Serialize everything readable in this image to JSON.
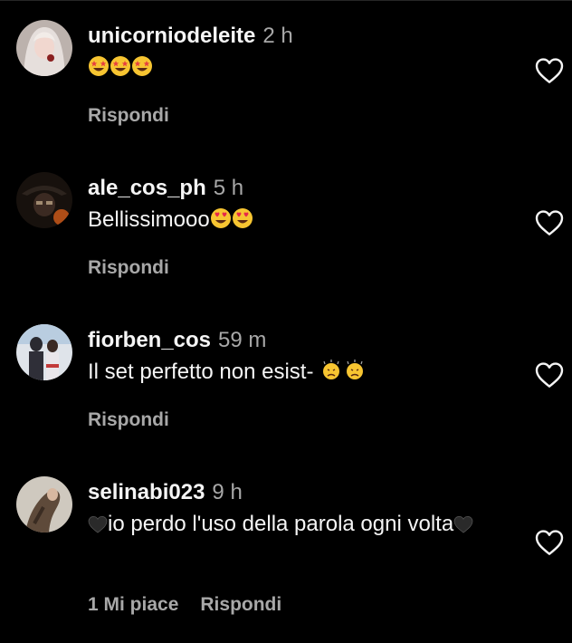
{
  "comments": [
    {
      "username": "unicorniodeleite",
      "time": "2 h",
      "text": "",
      "emoji": [
        "starstruck",
        "starstruck",
        "starstruck"
      ],
      "likes_label": "",
      "reply_label": "Rispondi",
      "avatar_colors": [
        "#d9d0cc",
        "#b9a9a3",
        "#7a2a2a"
      ]
    },
    {
      "username": "ale_cos_ph",
      "time": "5 h",
      "text": "Bellissimooo",
      "emoji": [
        "heart-eyes",
        "heart-eyes"
      ],
      "likes_label": "",
      "reply_label": "Rispondi",
      "avatar_colors": [
        "#1a1410",
        "#3a2a20",
        "#c05a1c"
      ]
    },
    {
      "username": "fiorben_cos",
      "time": "59 m",
      "text": "Il set perfetto non esist- ",
      "emoji": [
        "crying-face",
        "crying-face"
      ],
      "likes_label": "",
      "reply_label": "Rispondi",
      "avatar_colors": [
        "#d8dde2",
        "#2b2b33",
        "#a8c0d8"
      ]
    },
    {
      "username": "selinabi023",
      "time": "9 h",
      "text_before": "io perdo l'uso della parola ogni volta",
      "emoji": [
        "black-heart",
        "black-heart"
      ],
      "likes_label": "1 Mi piace",
      "reply_label": "Rispondi",
      "avatar_colors": [
        "#c8c2b8",
        "#6b5442",
        "#3a2c22"
      ]
    }
  ],
  "icons": {
    "like": "heart-outline-icon"
  },
  "colors": {
    "background": "#000000",
    "text": "#f5f5f5",
    "muted": "#a8a8a8"
  }
}
